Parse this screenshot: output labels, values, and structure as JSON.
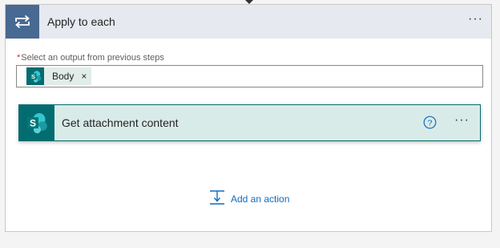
{
  "loop": {
    "title": "Apply to each",
    "more_label": "···",
    "field_label": "Select an output from previous steps",
    "required_mark": "*",
    "token": {
      "label": "Body",
      "remove": "×",
      "icon": "sharepoint-icon"
    }
  },
  "action": {
    "title": "Get attachment content",
    "icon": "sharepoint-icon",
    "help_icon": "question-circle-icon",
    "more_label": "···"
  },
  "add_action": {
    "label": "Add an action",
    "icon": "insert-step-icon"
  },
  "colors": {
    "loop_accent": "#486991",
    "sharepoint": "#036c70",
    "link": "#0f6cbd",
    "header_bg": "#e6e9f0",
    "action_bg": "#d9ebe8"
  }
}
